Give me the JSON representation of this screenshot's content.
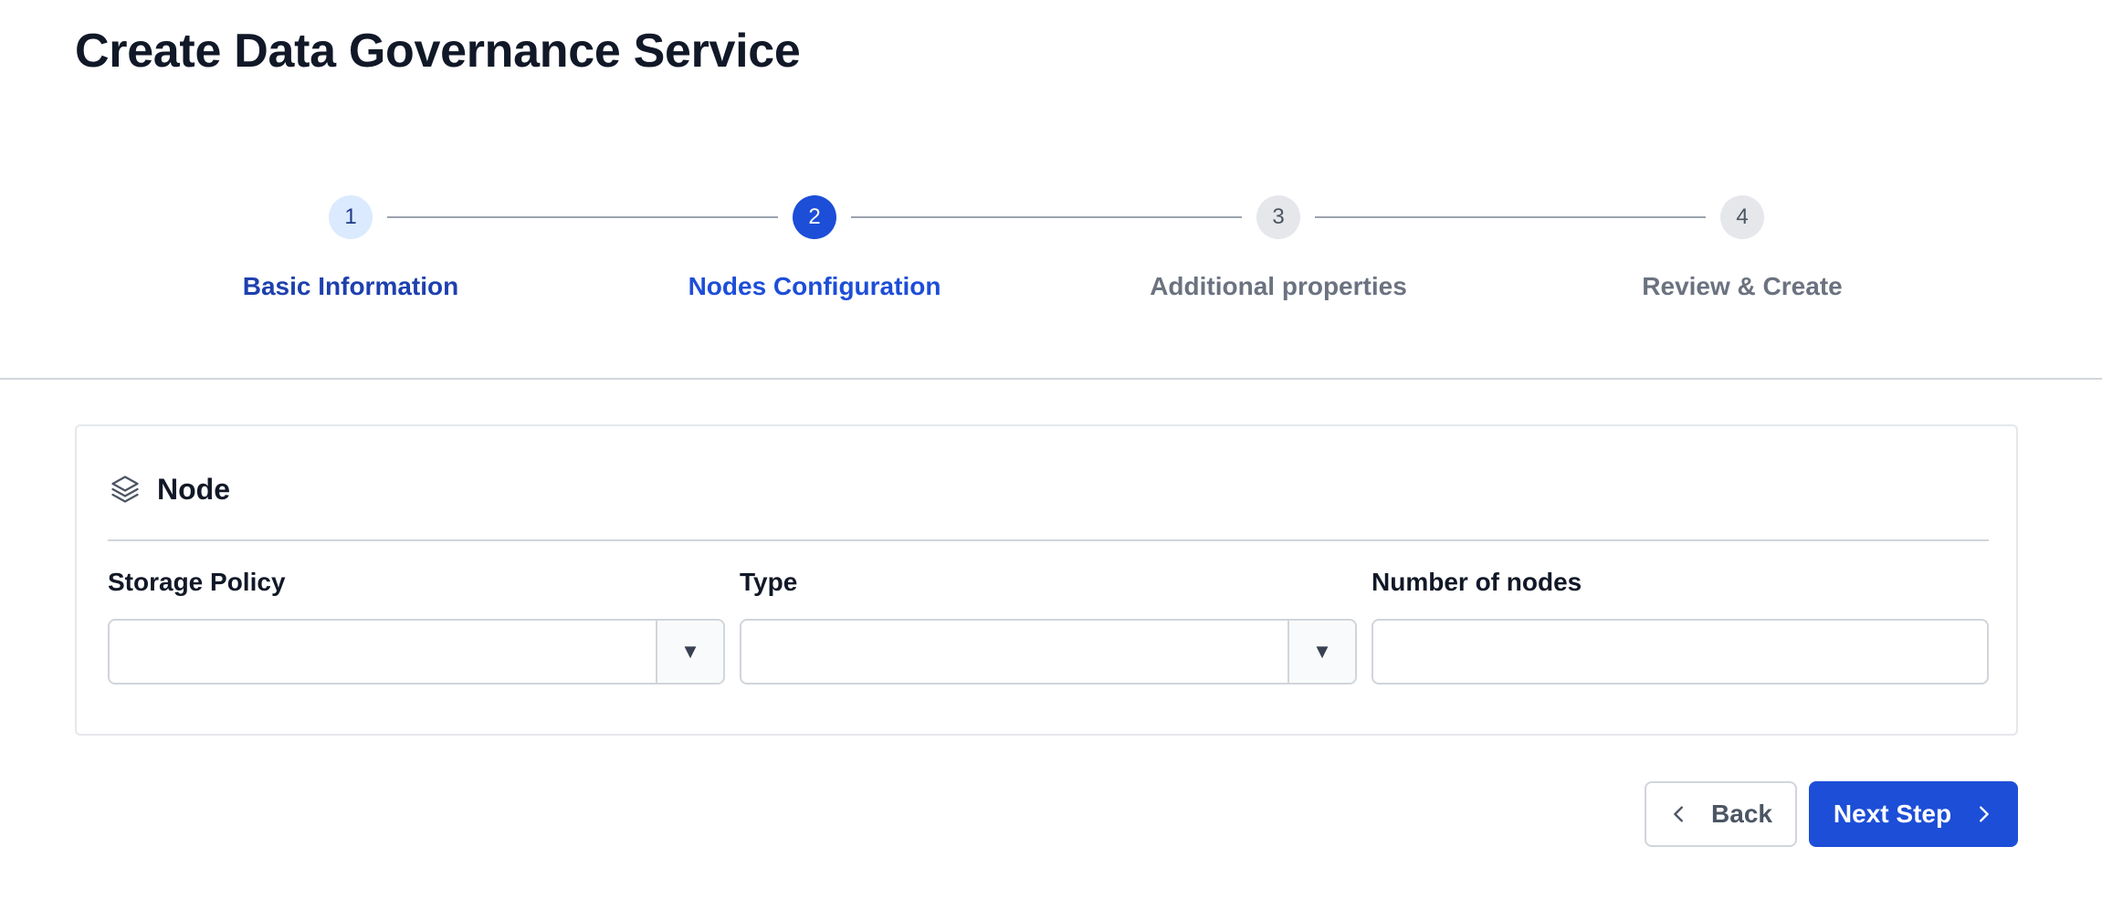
{
  "page": {
    "title": "Create Data Governance Service"
  },
  "stepper": {
    "steps": [
      {
        "number": "1",
        "label": "Basic Information",
        "state": "done"
      },
      {
        "number": "2",
        "label": "Nodes Configuration",
        "state": "active"
      },
      {
        "number": "3",
        "label": "Additional properties",
        "state": "pending"
      },
      {
        "number": "4",
        "label": "Review & Create",
        "state": "pending"
      }
    ]
  },
  "card": {
    "title": "Node",
    "icon": "layers-icon",
    "fields": {
      "storage_policy": {
        "label": "Storage Policy",
        "value": "",
        "kind": "select"
      },
      "type": {
        "label": "Type",
        "value": "",
        "kind": "select"
      },
      "number_of_nodes": {
        "label": "Number of nodes",
        "value": "",
        "kind": "input"
      }
    }
  },
  "actions": {
    "back_label": "Back",
    "next_label": "Next Step"
  },
  "colors": {
    "primary": "#1d4ed8",
    "done_circle": "#dbeafe",
    "pending_circle": "#e5e7eb",
    "muted_text": "#6b7280"
  }
}
